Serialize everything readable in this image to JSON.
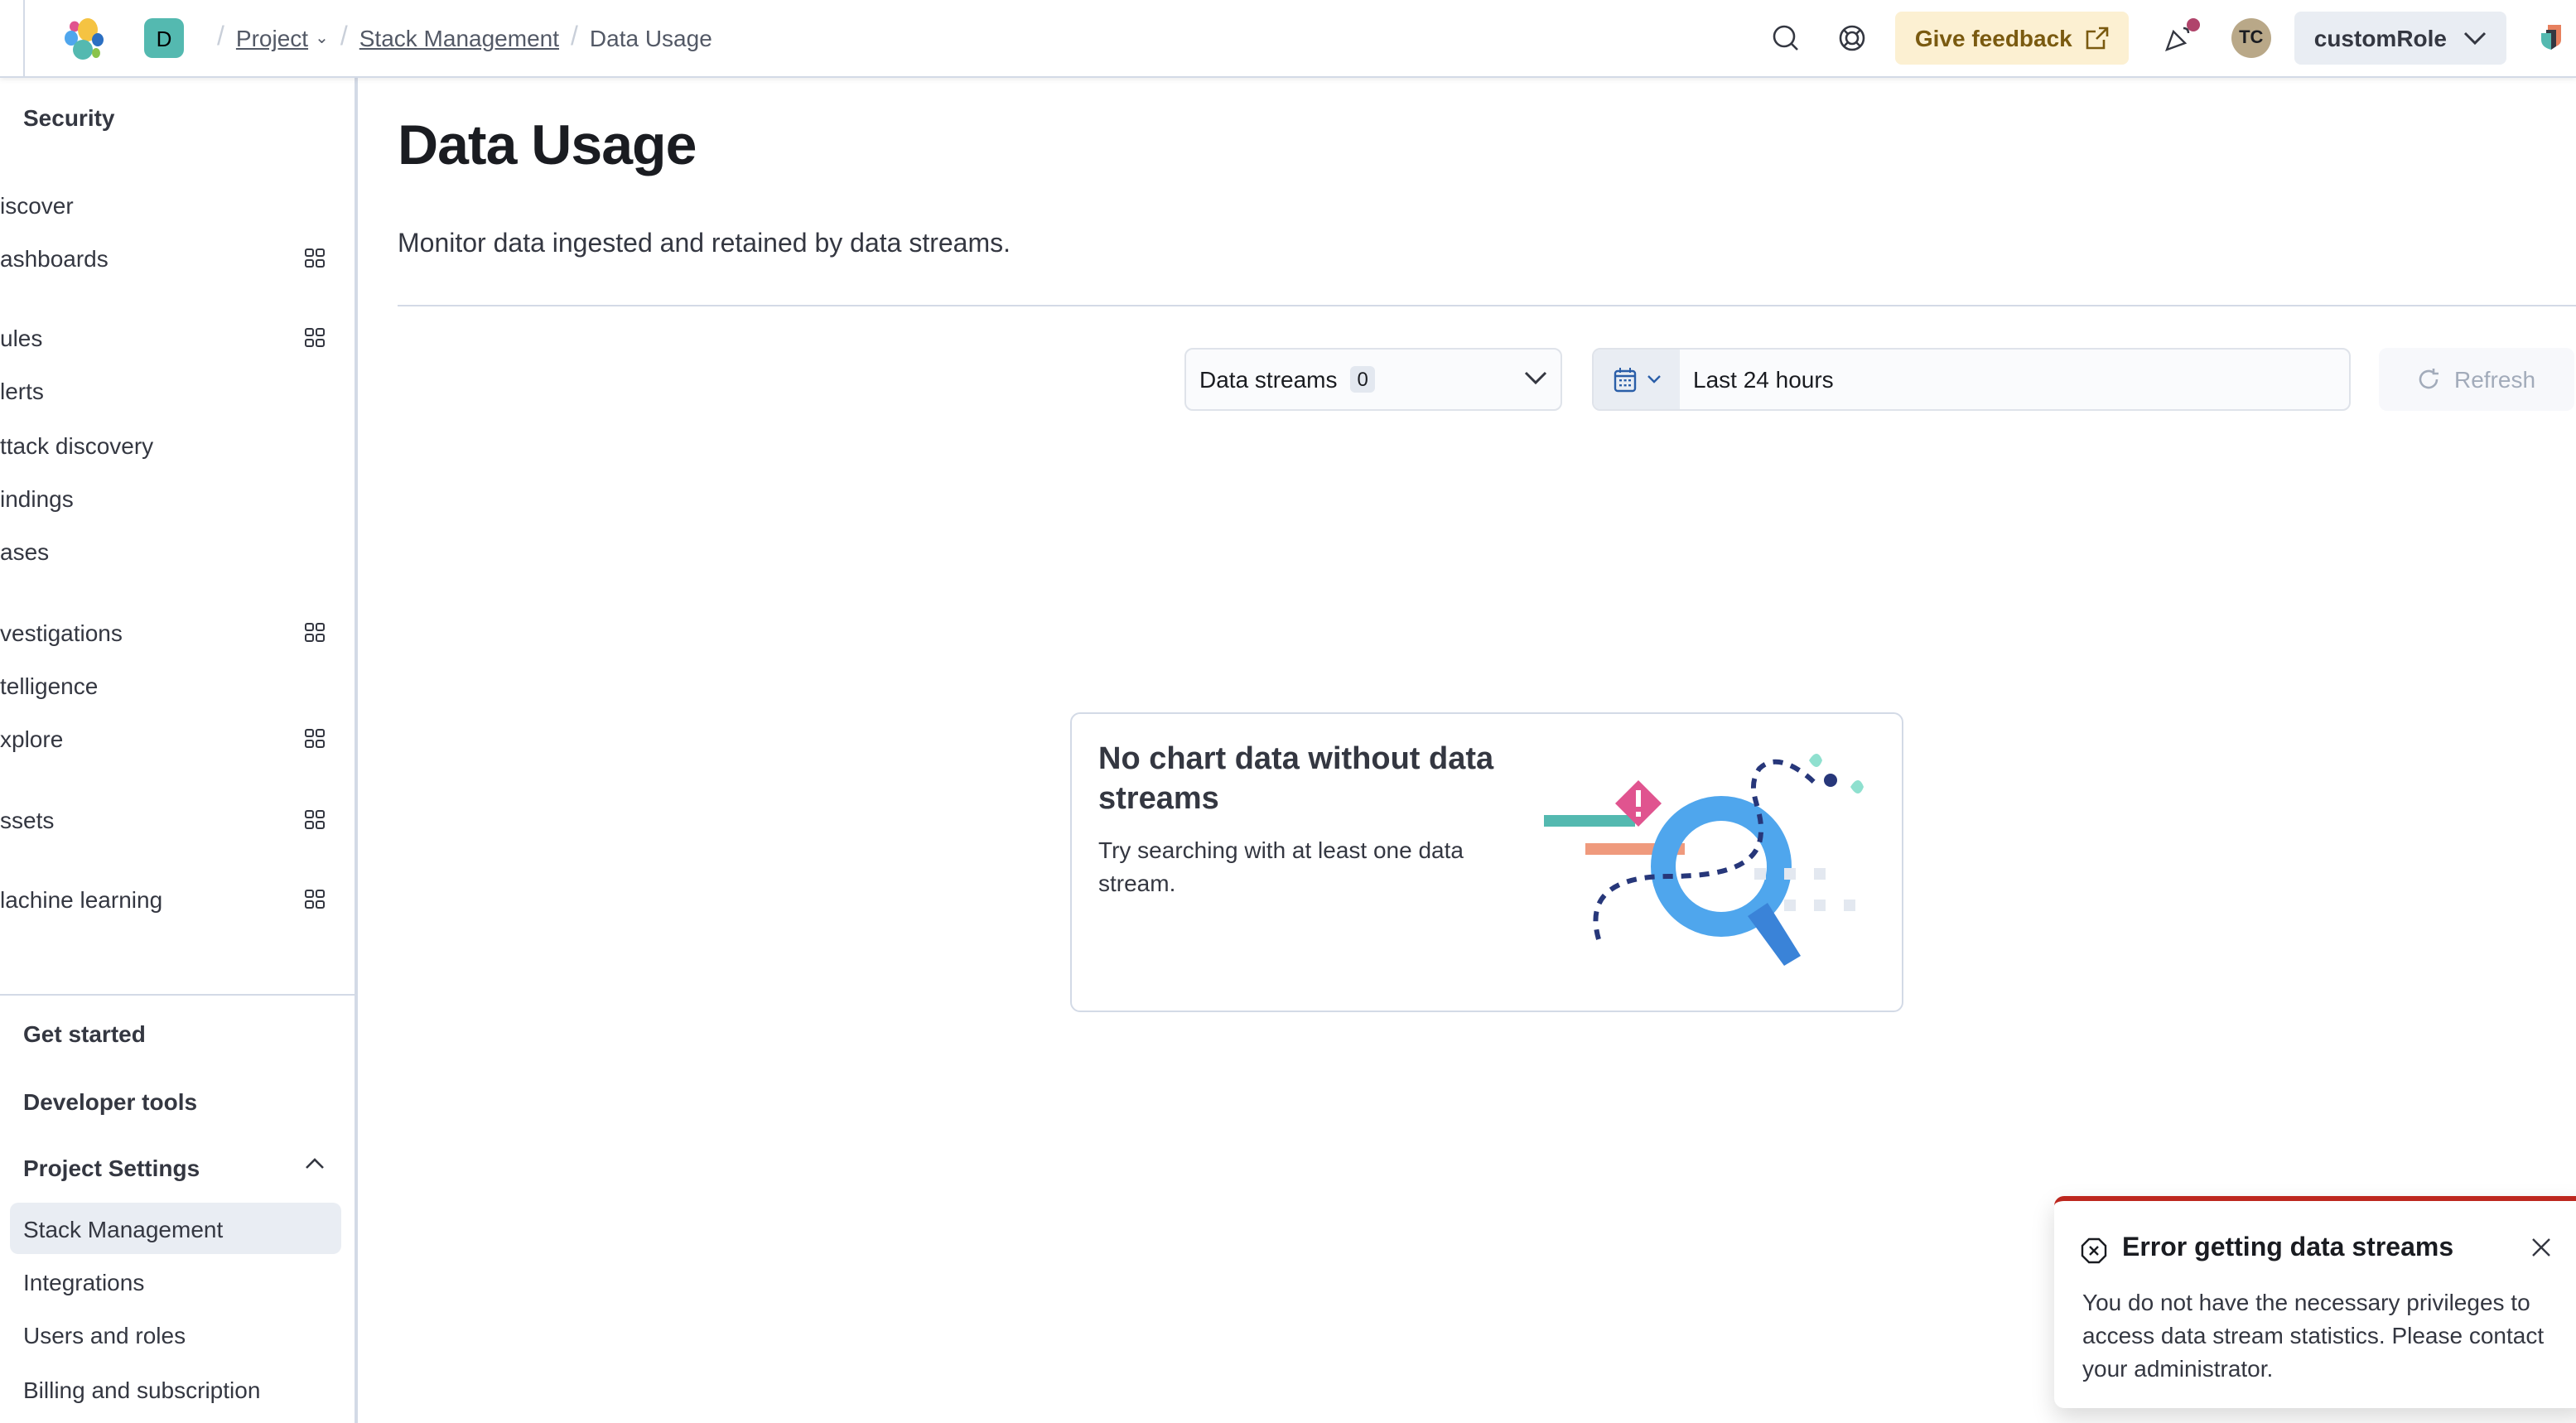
{
  "header": {
    "space_initial": "D",
    "breadcrumbs": [
      {
        "label": "Project",
        "has_dropdown": true
      },
      {
        "label": "Stack Management"
      },
      {
        "label": "Data Usage"
      }
    ],
    "feedback_label": "Give feedback",
    "avatar_initials": "TC",
    "role_label": "customRole",
    "icons": [
      "elastic-logo",
      "search-icon",
      "help-icon",
      "external-link-icon",
      "news-feed-icon",
      "chevron-down-icon",
      "security-shield-icon"
    ]
  },
  "sidebar": {
    "title": "Security",
    "items": [
      {
        "label": "iscover",
        "has_panel": false
      },
      {
        "label": "ashboards",
        "has_panel": true
      },
      {
        "label": "ules",
        "has_panel": true
      },
      {
        "label": "lerts",
        "has_panel": false
      },
      {
        "label": "ttack discovery",
        "has_panel": false
      },
      {
        "label": "indings",
        "has_panel": false
      },
      {
        "label": "ases",
        "has_panel": false
      },
      {
        "label": "vestigations",
        "has_panel": true
      },
      {
        "label": "telligence",
        "has_panel": false
      },
      {
        "label": "xplore",
        "has_panel": true
      },
      {
        "label": "ssets",
        "has_panel": true
      },
      {
        "label": "lachine learning",
        "has_panel": true
      }
    ],
    "footer": {
      "get_started": "Get started",
      "developer_tools": "Developer tools",
      "project_settings": "Project Settings",
      "project_settings_items": [
        {
          "label": "Stack Management",
          "active": true
        },
        {
          "label": "Integrations",
          "active": false
        },
        {
          "label": "Users and roles",
          "active": false
        },
        {
          "label": "Billing and subscription",
          "active": false
        }
      ]
    }
  },
  "main": {
    "title": "Data Usage",
    "description": "Monitor data ingested and retained by data streams.",
    "data_streams_label": "Data streams",
    "data_streams_count": "0",
    "date_range": "Last 24 hours",
    "refresh_label": "Refresh",
    "empty_state": {
      "title": "No chart data without data streams",
      "body": "Try searching with at least one data stream."
    }
  },
  "toast": {
    "title": "Error getting data streams",
    "body": "You do not have the necessary privileges to access data stream statistics. Please contact your administrator.",
    "accent_color": "#bd271e"
  },
  "colors": {
    "feedback_bg": "#fcf0d2",
    "active_item_bg": "#e9edf3",
    "space_badge": "#54b9b0"
  }
}
